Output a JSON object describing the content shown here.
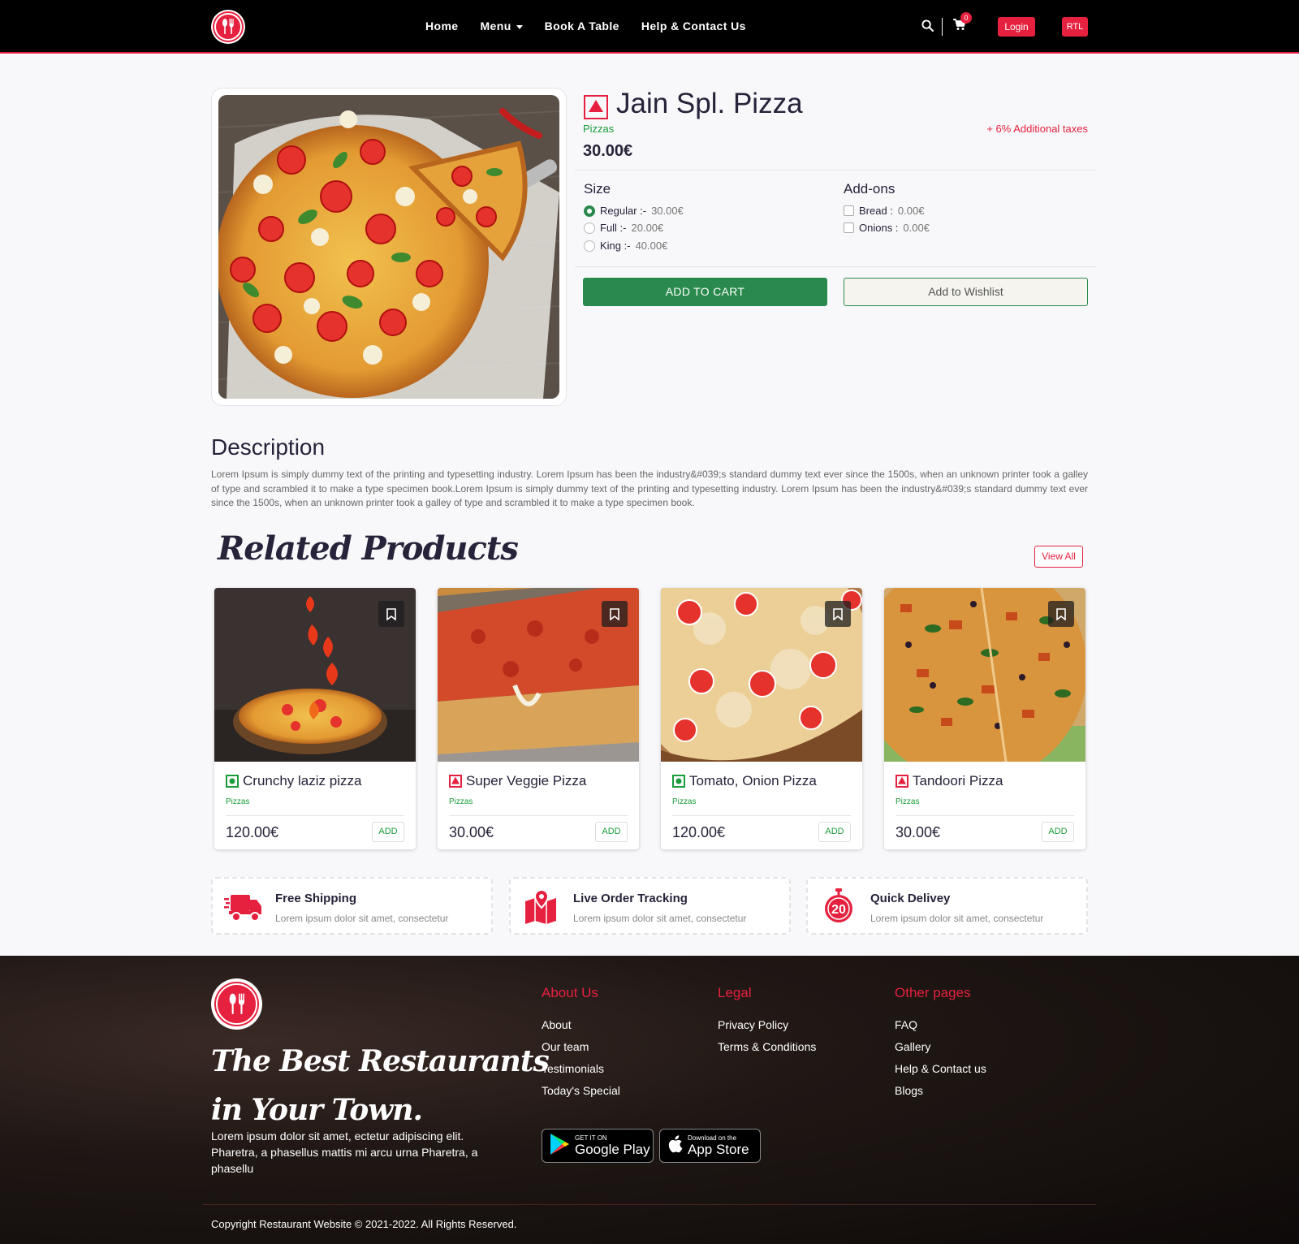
{
  "colors": {
    "brand": "#e5213f",
    "green": "#2a8a4e",
    "veg": "#1a9c3a",
    "dark": "#26233a"
  },
  "nav": {
    "links": [
      "Home",
      "Menu",
      "Book A Table",
      "Help & Contact Us"
    ],
    "cart_count": "0",
    "login": "Login",
    "rtl": "RTL"
  },
  "product": {
    "title": "Jain Spl. Pizza",
    "food_type": "non-veg",
    "category": "Pizzas",
    "tax_note": "+ 6% Additional taxes",
    "price": "30.00€",
    "size_heading": "Size",
    "sizes": [
      {
        "label": "Regular :-",
        "price": "30.00€",
        "selected": true
      },
      {
        "label": "Full :-",
        "price": "20.00€",
        "selected": false
      },
      {
        "label": "King :-",
        "price": "40.00€",
        "selected": false
      }
    ],
    "addons_heading": "Add-ons",
    "addons": [
      {
        "label": "Bread :",
        "price": "0.00€"
      },
      {
        "label": "Onions :",
        "price": "0.00€"
      }
    ],
    "add_to_cart": "ADD TO CART",
    "add_to_wishlist": "Add to Wishlist"
  },
  "description": {
    "heading": "Description",
    "text": "Lorem Ipsum is simply dummy text of the printing and typesetting industry. Lorem Ipsum has been the industry&#039;s standard dummy text ever since the 1500s, when an unknown printer took a galley of type and scrambled it to make a type specimen book.Lorem Ipsum is simply dummy text of the printing and typesetting industry. Lorem Ipsum has been the industry&#039;s standard dummy text ever since the 1500s, when an unknown printer took a galley of type and scrambled it to make a type specimen book."
  },
  "related": {
    "heading": "Related Products",
    "view_all": "View All",
    "items": [
      {
        "name": "Crunchy laziz pizza",
        "type": "veg",
        "category": "Pizzas",
        "price": "120.00€",
        "add": "ADD"
      },
      {
        "name": "Super Veggie Pizza",
        "type": "non-veg",
        "category": "Pizzas",
        "price": "30.00€",
        "add": "ADD"
      },
      {
        "name": "Tomato, Onion Pizza",
        "type": "veg",
        "category": "Pizzas",
        "price": "120.00€",
        "add": "ADD"
      },
      {
        "name": "Tandoori Pizza",
        "type": "non-veg",
        "category": "Pizzas",
        "price": "30.00€",
        "add": "ADD"
      }
    ]
  },
  "features": [
    {
      "title": "Free Shipping",
      "text": "Lorem ipsum dolor sit amet, consectetur",
      "icon": "truck-icon"
    },
    {
      "title": "Live Order Tracking",
      "text": "Lorem ipsum dolor sit amet, consectetur",
      "icon": "map-pin-icon"
    },
    {
      "title": "Quick Delivey",
      "text": "Lorem ipsum dolor sit amet, consectetur",
      "icon": "stopwatch-icon",
      "badge": "20"
    }
  ],
  "footer": {
    "tagline_line1": "The Best Restaurants",
    "tagline_line2": "in Your Town.",
    "text": "Lorem ipsum dolor sit amet, ectetur adipiscing elit. Pharetra, a phasellus mattis mi arcu urna Pharetra, a phasellu",
    "columns": [
      {
        "heading": "About Us",
        "links": [
          "About",
          "Our team",
          "Testimonials",
          "Today's Special"
        ]
      },
      {
        "heading": "Legal",
        "links": [
          "Privacy Policy",
          "Terms & Conditions"
        ]
      },
      {
        "heading": "Other pages",
        "links": [
          "FAQ",
          "Gallery",
          "Help & Contact us",
          "Blogs"
        ]
      }
    ],
    "google_play": {
      "small": "GET IT ON",
      "big": "Google Play"
    },
    "app_store": {
      "small": "Download on the",
      "big": "App Store"
    },
    "copyright": "Copyright Restaurant Website © 2021-2022. All Rights Reserved."
  }
}
